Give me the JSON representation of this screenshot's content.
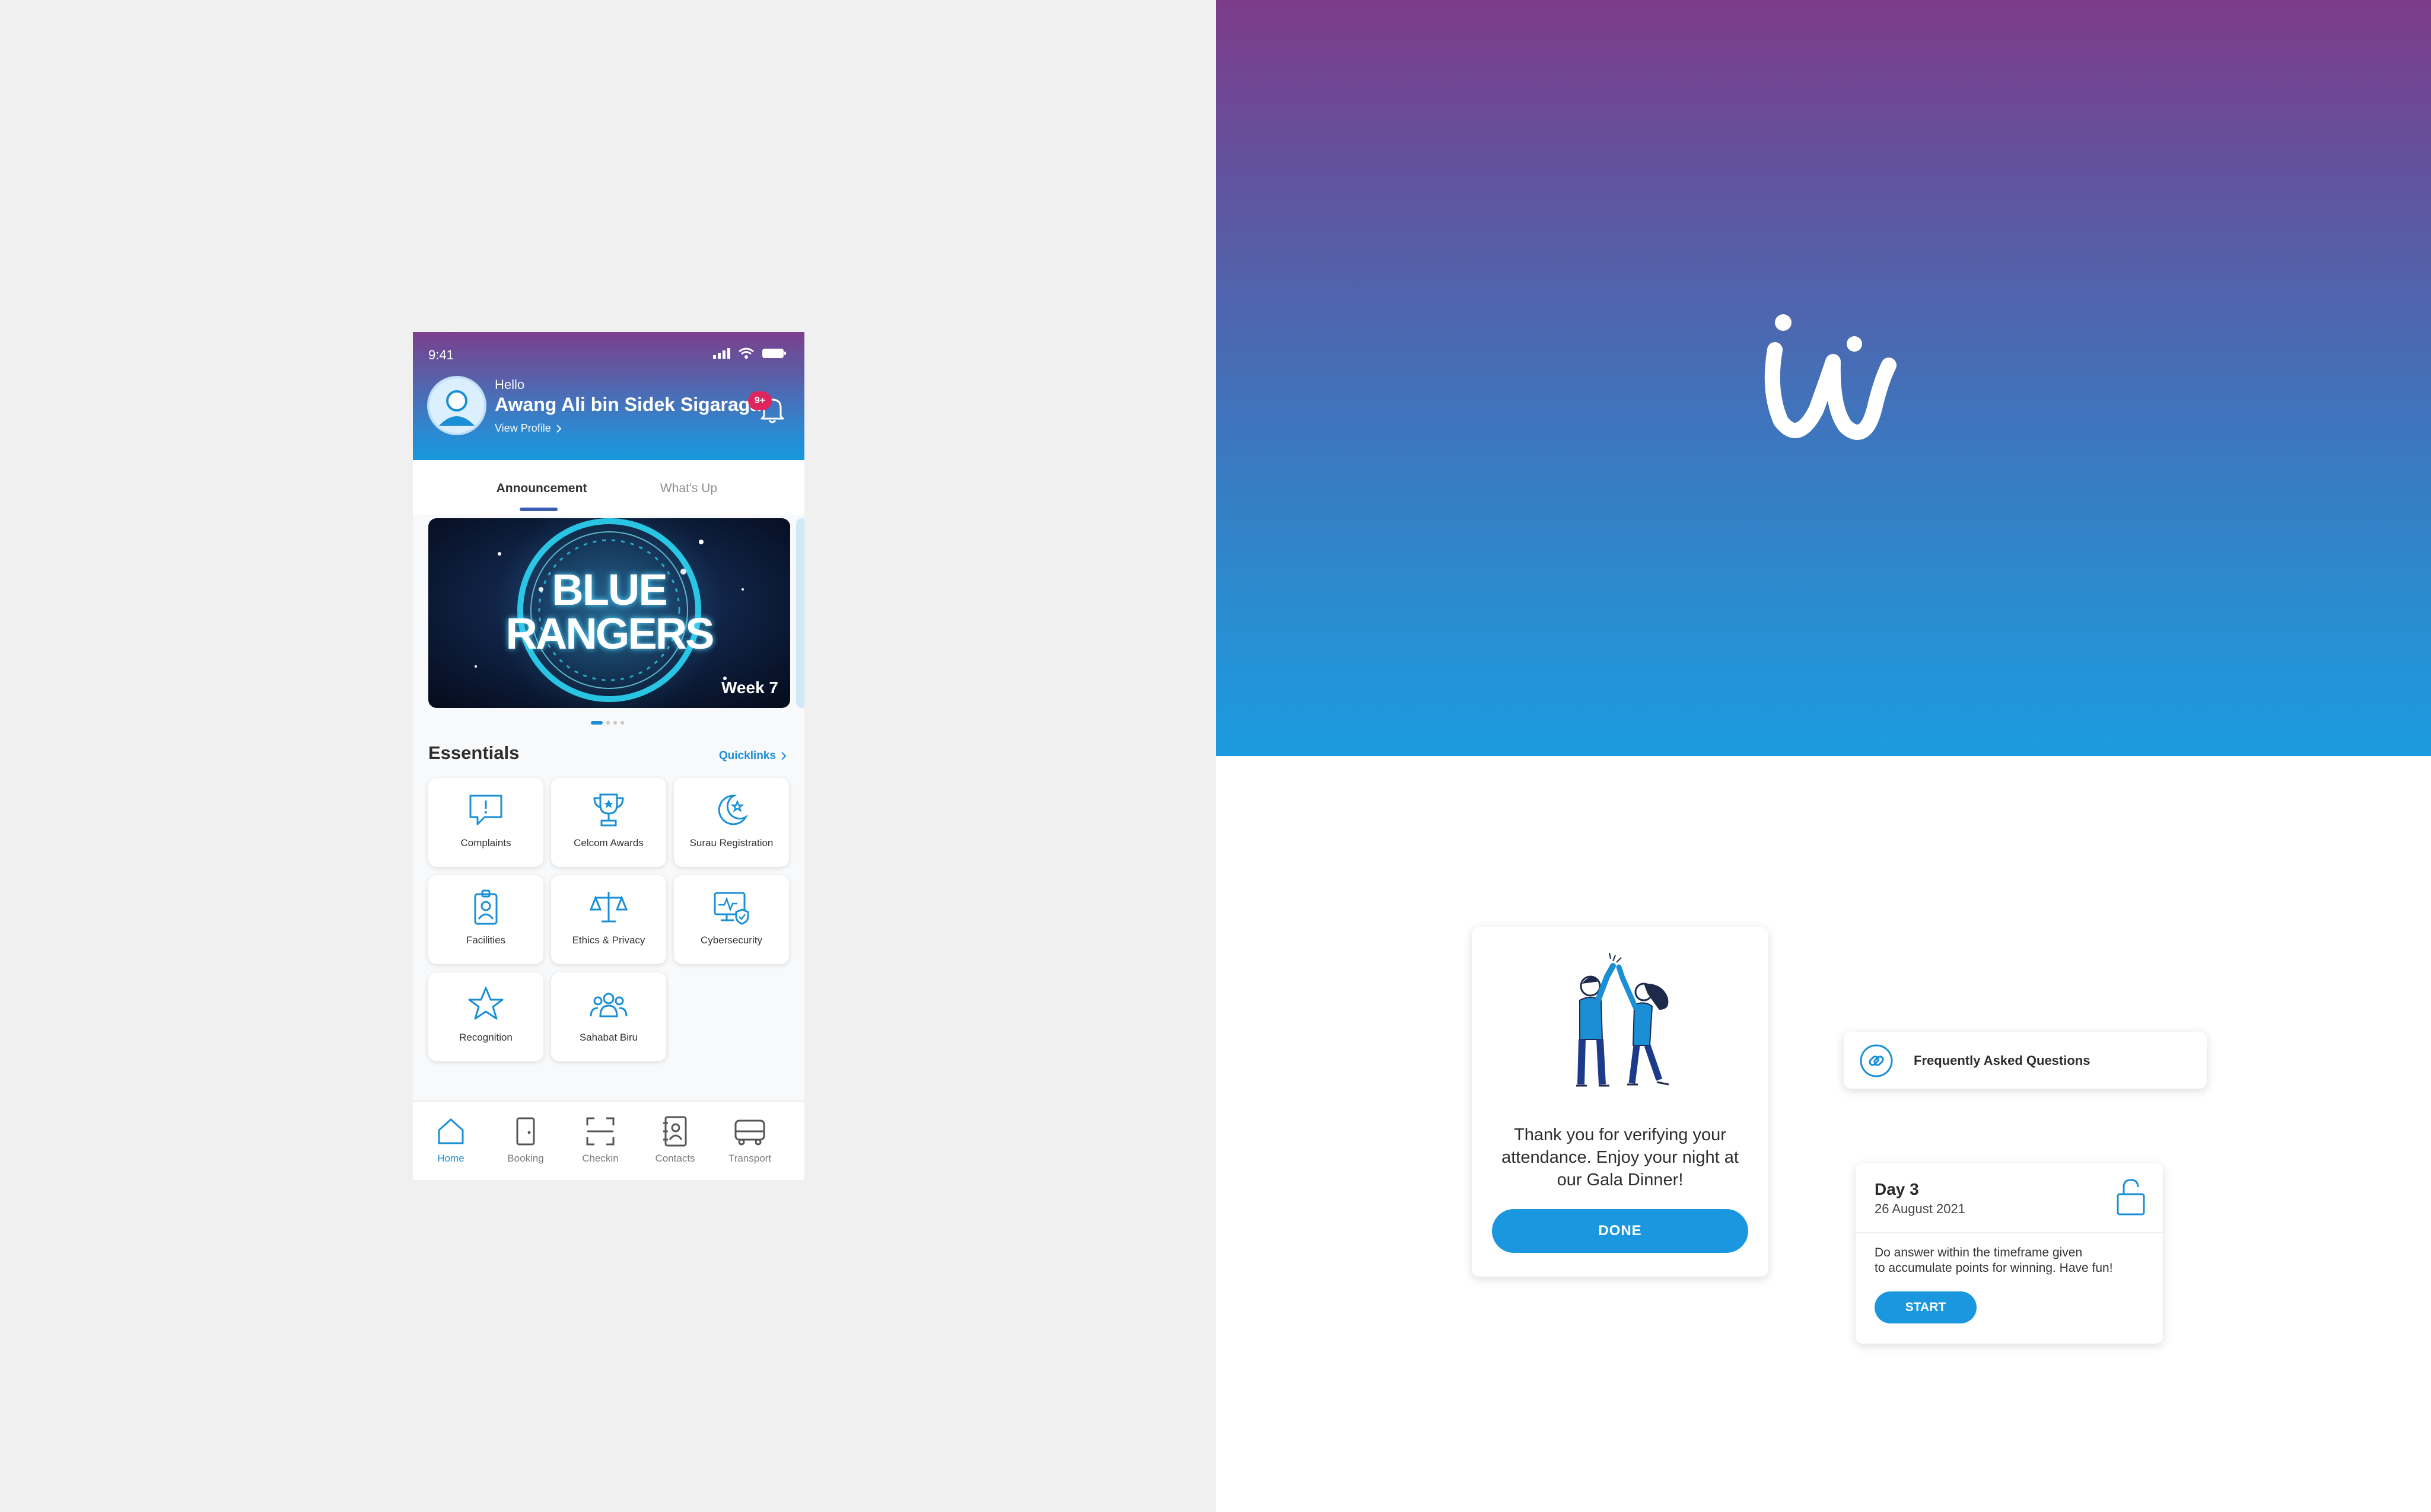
{
  "phone": {
    "status_time": "9:41",
    "greeting": "Hello",
    "user_name": "Awang Ali bin Sidek Sigaraga",
    "view_profile": "View Profile",
    "notification_count": "9+",
    "tabs": [
      "Announcement",
      "What's Up"
    ],
    "active_tab": "Announcement",
    "banner": {
      "line1": "BLUE",
      "line2": "RANGERS",
      "week": "Week 7"
    },
    "carousel_total": 4,
    "carousel_active": 1,
    "essentials_title": "Essentials",
    "quicklinks_label": "Quicklinks",
    "essentials": [
      {
        "label": "Complaints",
        "icon": "complaint-icon"
      },
      {
        "label": "Celcom Awards",
        "icon": "trophy-icon"
      },
      {
        "label": "Surau Registration",
        "icon": "crescent-star-icon"
      },
      {
        "label": "Facilities",
        "icon": "id-badge-icon"
      },
      {
        "label": "Ethics & Privacy",
        "icon": "scales-icon"
      },
      {
        "label": "Cybersecurity",
        "icon": "monitor-shield-icon"
      },
      {
        "label": "Recognition",
        "icon": "star-icon"
      },
      {
        "label": "Sahabat Biru",
        "icon": "people-group-icon"
      }
    ],
    "bottom_nav": [
      {
        "label": "Home",
        "icon": "home-icon",
        "active": true
      },
      {
        "label": "Booking",
        "icon": "door-icon",
        "active": false
      },
      {
        "label": "Checkin",
        "icon": "scan-icon",
        "active": false
      },
      {
        "label": "Contacts",
        "icon": "address-book-icon",
        "active": false
      },
      {
        "label": "Transport",
        "icon": "bus-icon",
        "active": false
      }
    ]
  },
  "gala_card": {
    "message": "Thank you for verifying your attendance. Enjoy your night at our Gala Dinner!",
    "button": "DONE"
  },
  "faq_card": {
    "label": "Frequently Asked Questions",
    "icon": "link-icon"
  },
  "day_card": {
    "title": "Day 3",
    "date": "26 August 2021",
    "description_line1": "Do answer within the timeframe given",
    "description_line2": "to accumulate points for winning. Have fun!",
    "button": "START",
    "icon": "unlock-icon"
  },
  "colors": {
    "accent": "#1a97de",
    "gradient_top": "#7d3b8a",
    "gradient_bottom": "#1c9be0",
    "badge": "#e0245e"
  }
}
